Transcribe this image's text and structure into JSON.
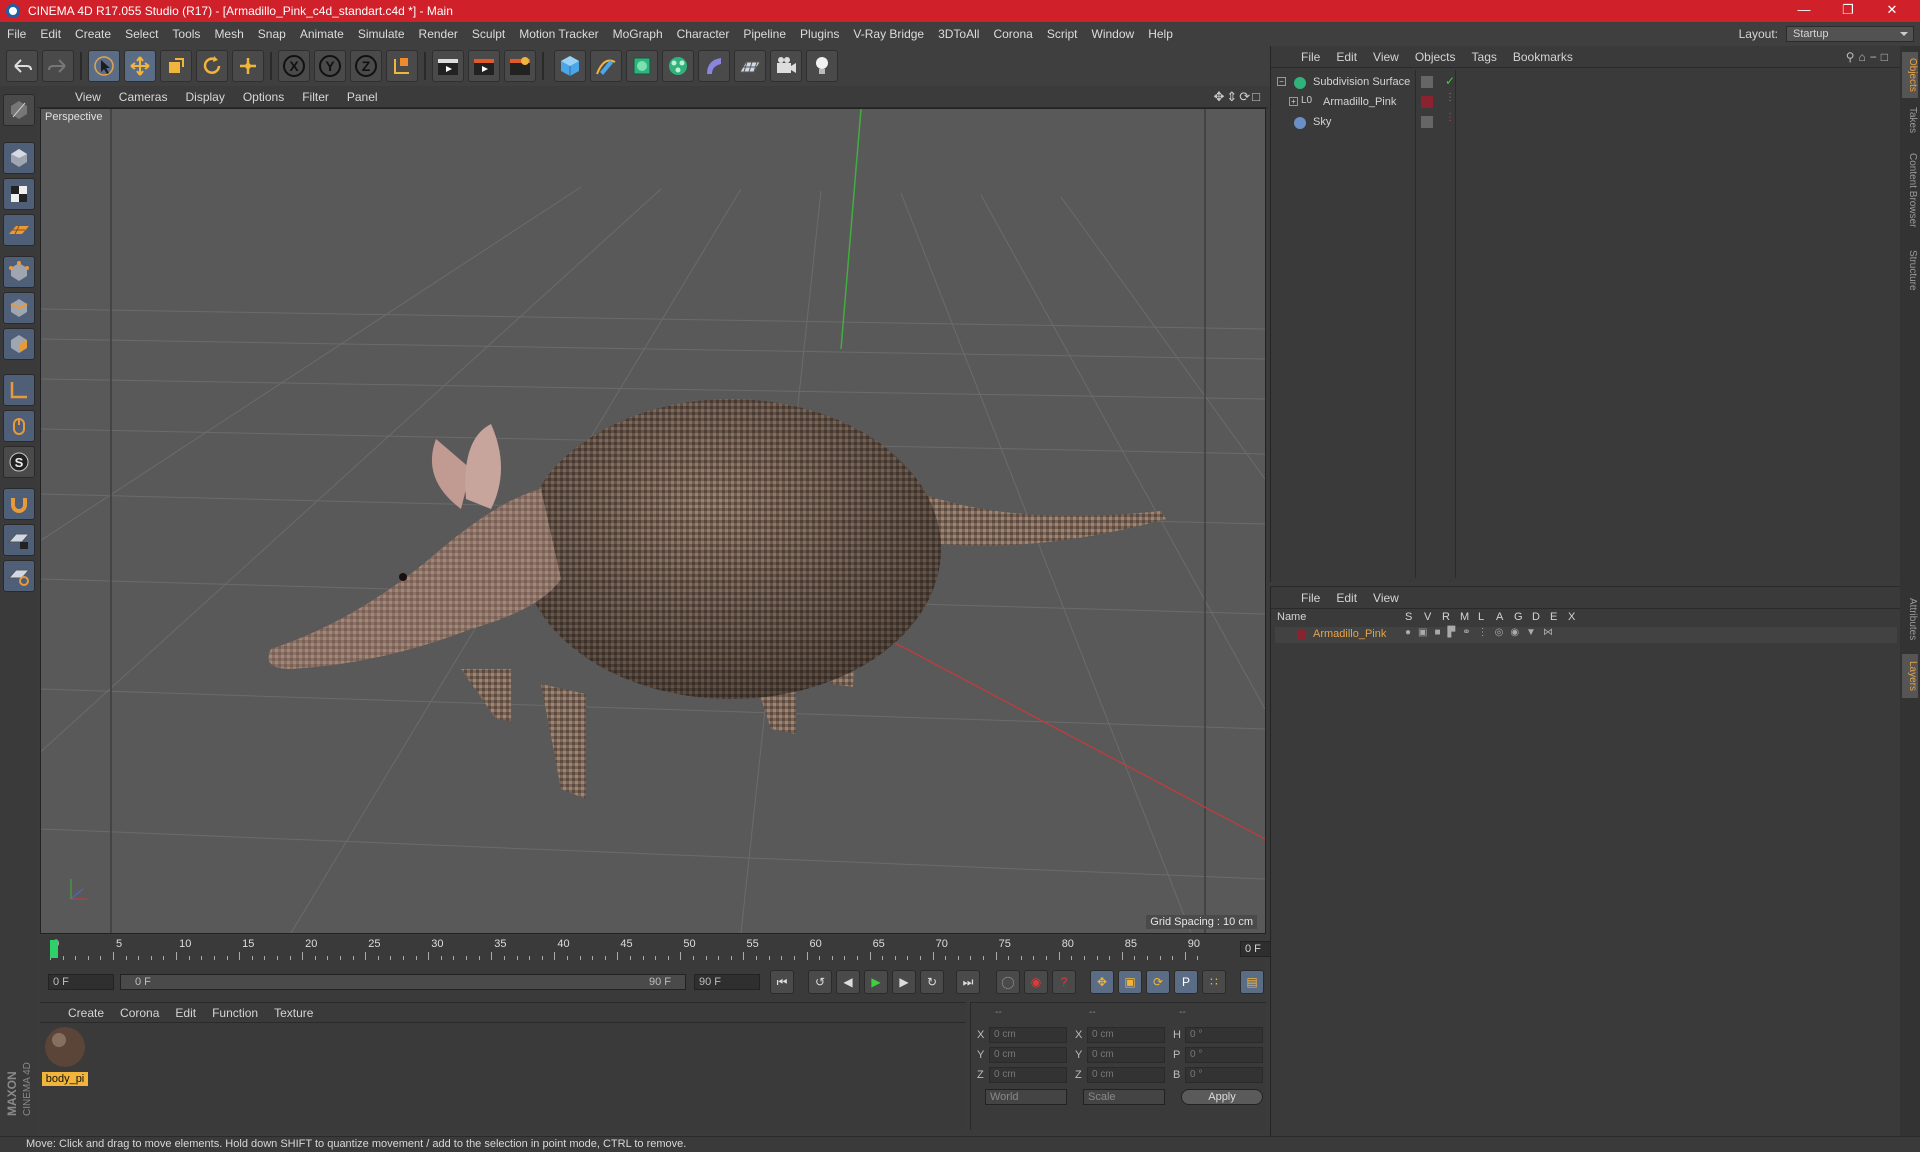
{
  "window": {
    "title": "CINEMA 4D R17.055 Studio (R17) - [Armadillo_Pink_c4d_standart.c4d *] - Main"
  },
  "menubar": {
    "items": [
      "File",
      "Edit",
      "Create",
      "Select",
      "Tools",
      "Mesh",
      "Snap",
      "Animate",
      "Simulate",
      "Render",
      "Sculpt",
      "Motion Tracker",
      "MoGraph",
      "Character",
      "Pipeline",
      "Plugins",
      "V-Ray Bridge",
      "3DToAll",
      "Corona",
      "Script",
      "Window",
      "Help"
    ],
    "layout_label": "Layout:",
    "layout_value": "Startup"
  },
  "viewport": {
    "menu": [
      "View",
      "Cameras",
      "Display",
      "Options",
      "Filter",
      "Panel"
    ],
    "name": "Perspective",
    "grid_spacing": "Grid Spacing : 10 cm"
  },
  "timeline": {
    "ticks": [
      "0",
      "5",
      "10",
      "15",
      "20",
      "25",
      "30",
      "35",
      "40",
      "45",
      "50",
      "55",
      "60",
      "65",
      "70",
      "75",
      "80",
      "85",
      "90"
    ],
    "current_frame": "0 F"
  },
  "transport": {
    "start": "0 F",
    "range_start": "0 F",
    "range_end": "90 F",
    "end": "90 F"
  },
  "material_panel": {
    "menu": [
      "Create",
      "Corona",
      "Edit",
      "Function",
      "Texture"
    ],
    "material_name": "body_pi"
  },
  "coordinates": {
    "headers": [
      "--",
      "--",
      "--"
    ],
    "rows": [
      {
        "a": "X",
        "av": "0 cm",
        "b": "X",
        "bv": "0 cm",
        "c": "H",
        "cv": "0 °"
      },
      {
        "a": "Y",
        "av": "0 cm",
        "b": "Y",
        "bv": "0 cm",
        "c": "P",
        "cv": "0 °"
      },
      {
        "a": "Z",
        "av": "0 cm",
        "b": "Z",
        "bv": "0 cm",
        "c": "B",
        "cv": "0 °"
      }
    ],
    "mode": "World",
    "scale": "Scale",
    "apply": "Apply"
  },
  "objects_panel": {
    "menu": [
      "File",
      "Edit",
      "View",
      "Objects",
      "Tags",
      "Bookmarks"
    ],
    "objects": [
      "Subdivision Surface",
      "Armadillo_Pink",
      "Sky"
    ]
  },
  "layers_panel": {
    "menu": [
      "File",
      "Edit",
      "View"
    ],
    "columns": [
      "Name",
      "S",
      "V",
      "R",
      "M",
      "L",
      "A",
      "G",
      "D",
      "E",
      "X"
    ],
    "layer_name": "Armadillo_Pink"
  },
  "side_tabs": [
    "Objects",
    "Takes",
    "Content Browser",
    "Structure",
    "Attributes",
    "Layers"
  ],
  "brand": "MAXON CINEMA 4D",
  "status": "Move: Click and drag to move elements. Hold down SHIFT to quantize movement / add to the selection in point mode, CTRL to remove.",
  "colors": {
    "title_bar": "#d0202a",
    "accent": "#e6a34a",
    "layer_color": "#8a2230"
  }
}
